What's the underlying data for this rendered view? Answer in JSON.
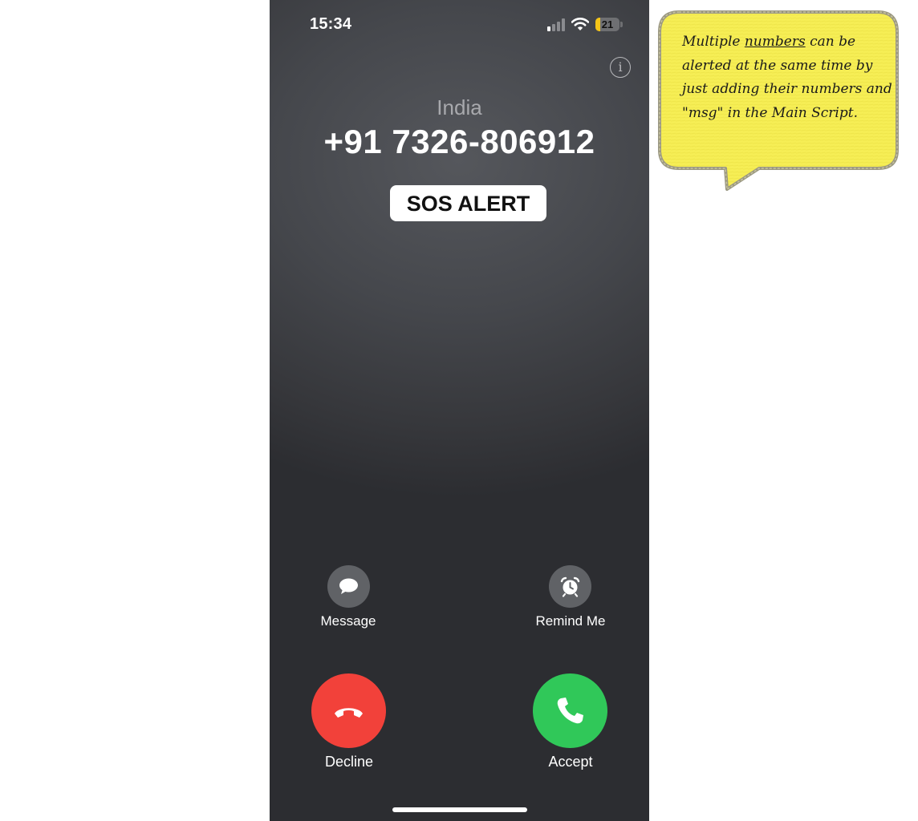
{
  "status_bar": {
    "time": "15:34",
    "battery_percent": "21",
    "signal_bars_active": 1,
    "signal_bars_total": 4
  },
  "call": {
    "caller_label": "India",
    "caller_number": "+91 7326-806912",
    "sos_badge": "SOS ALERT"
  },
  "actions": {
    "message_label": "Message",
    "remind_label": "Remind Me",
    "decline_label": "Decline",
    "accept_label": "Accept"
  },
  "annotation": {
    "text_before": "Multiple ",
    "text_underlined": "numbers",
    "text_after": " can be alerted at the same time by just adding their numbers and \"msg\" in the Main Script."
  },
  "colors": {
    "decline": "#f2413a",
    "accept": "#30c859",
    "note_fill": "#f6ee55"
  },
  "icons": [
    "info-icon",
    "message-bubble-icon",
    "alarm-clock-icon",
    "hang-up-icon",
    "phone-icon",
    "wifi-icon",
    "signal-icon",
    "battery-icon"
  ]
}
